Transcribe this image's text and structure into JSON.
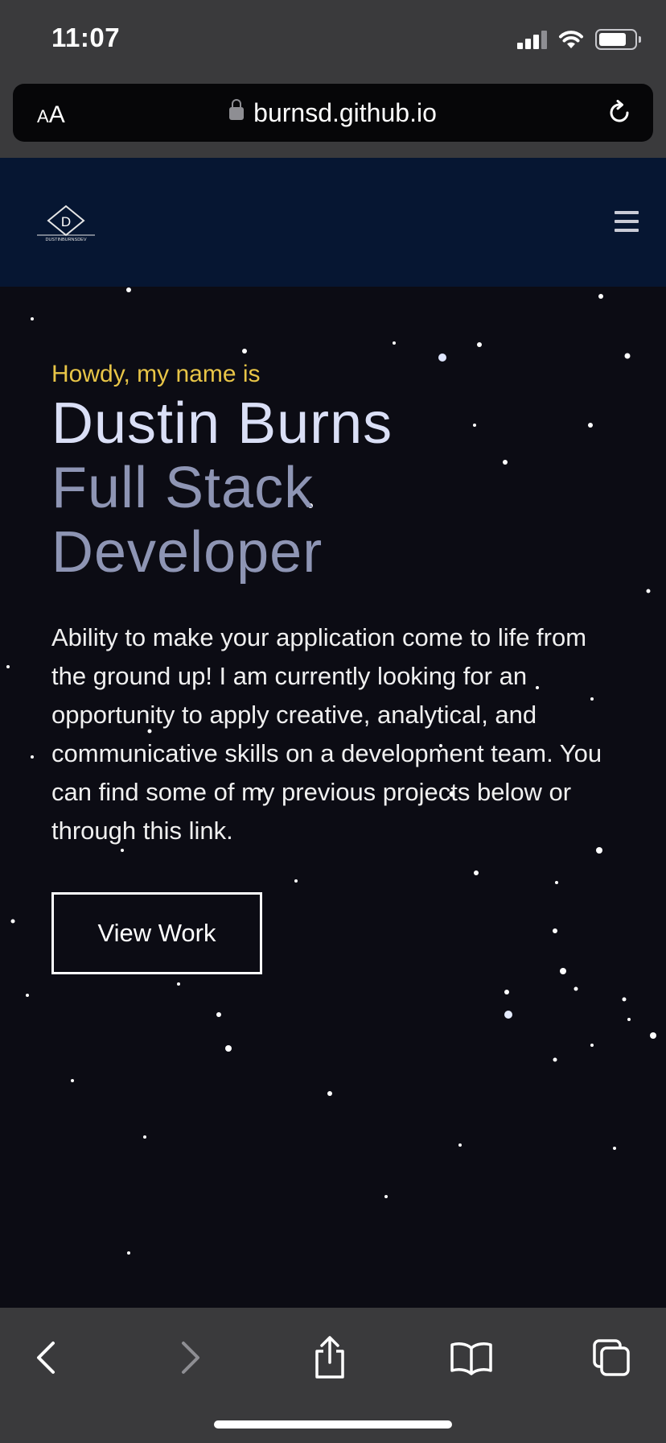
{
  "status_bar": {
    "time": "11:07",
    "icons": [
      "signal-icon",
      "wifi-icon",
      "battery-icon"
    ]
  },
  "browser": {
    "text_size_label_small": "A",
    "text_size_label_large": "A",
    "url": "burnsd.github.io",
    "icons": [
      "lock-icon",
      "reload-icon"
    ]
  },
  "site_header": {
    "logo_letter": "D",
    "logo_text": "DUSTINBURNSDEV",
    "menu_icon": "hamburger-menu-icon"
  },
  "hero": {
    "greeting": "Howdy, my name is",
    "name": "Dustin Burns",
    "role_line1": "Full Stack",
    "role_line2": "Developer",
    "description": "Ability to make your application come to life from the ground up! I am currently looking for an opportunity to apply creative, analytical, and communicative skills on a development team. You can find some of my previous projects below or through this link.",
    "cta_label": "View Work"
  },
  "toolbar": {
    "icons": [
      "back-icon",
      "forward-icon",
      "share-icon",
      "bookmarks-icon",
      "tabs-icon"
    ]
  },
  "colors": {
    "header_bg": "#061632",
    "greeting": "#e8c547",
    "name": "#dadff6",
    "role": "#8e95b4",
    "browser_chrome": "#3a3a3c"
  }
}
